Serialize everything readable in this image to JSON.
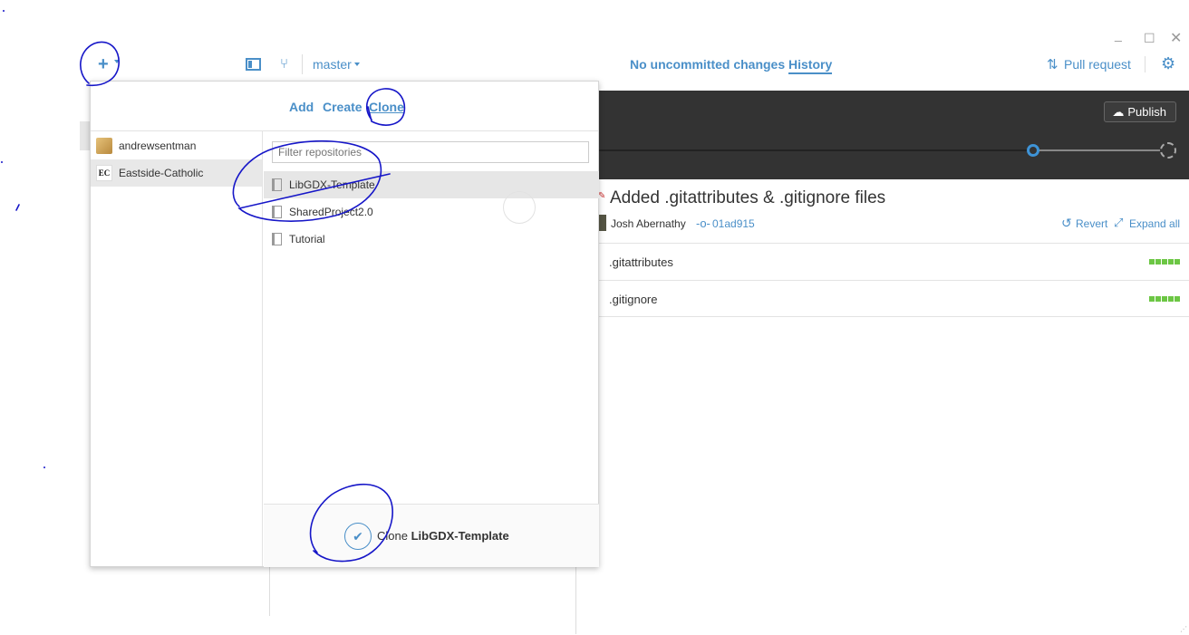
{
  "window": {
    "minimize": "_",
    "maximize": "☐",
    "close": "✕"
  },
  "toolbar": {
    "add_icon": "+",
    "branch_icon": "⑂",
    "branch": "master",
    "tab_changes": "No uncommitted changes",
    "tab_history": "History",
    "pull_icon": "⇅",
    "pull_request": "Pull request",
    "gear_icon": "⚙"
  },
  "popover": {
    "tabs": {
      "add": "Add",
      "create": "Create",
      "clone": "Clone"
    },
    "accounts": [
      {
        "name": "andrewsentman",
        "avatar": "doge-avatar"
      },
      {
        "name": "Eastside-Catholic",
        "avatar": "EC",
        "selected": true
      }
    ],
    "filter_placeholder": "Filter repositories",
    "repos": [
      {
        "name": "LibGDX-Template",
        "selected": true
      },
      {
        "name": "SharedProject2.0"
      },
      {
        "name": "Tutorial"
      }
    ],
    "footer": {
      "check": "✔",
      "action": "Clone",
      "repo": "LibGDX-Template"
    }
  },
  "timeline": {
    "publish_icon": "☁",
    "publish": "Publish"
  },
  "commit": {
    "title_icon": "✎",
    "title": "Added .gitattributes & .gitignore files",
    "author": "Josh Abernathy",
    "sha_icon": "-o-",
    "sha": "01ad915",
    "revert_icon": "↺",
    "revert": "Revert",
    "expand_icon": "⤢",
    "expand": "Expand all",
    "files": [
      {
        "name": ".gitattributes",
        "diff_blocks": 5
      },
      {
        "name": ".gitignore",
        "diff_blocks": 5
      }
    ]
  },
  "colors": {
    "accent": "#4a8fc8",
    "timeline_bg": "#333333",
    "diff_add": "#6cc644",
    "annotation_ink": "#1616c8"
  }
}
